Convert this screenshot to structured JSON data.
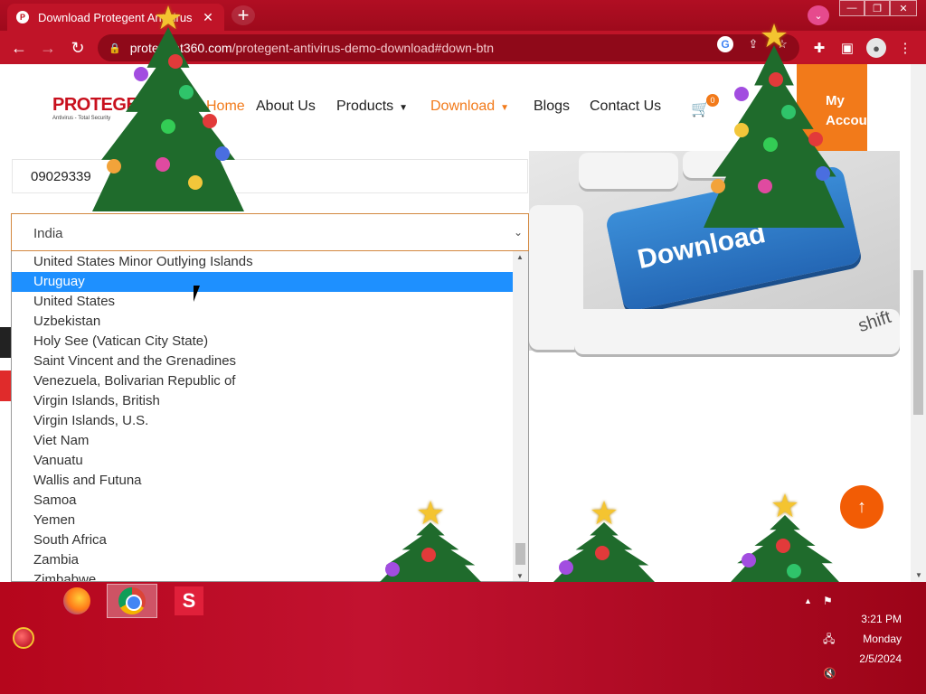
{
  "browser": {
    "tab_title": "Download Protegent Antivirus Demo",
    "tab_favicon": "P",
    "url_host": "protegent360.com",
    "url_path": "/protegent-antivirus-demo-download#down-btn"
  },
  "site": {
    "logo_brand": "PROTEGENT",
    "logo_tagline": "Antivirus - Total Security",
    "nav": {
      "home": "Home",
      "about": "About Us",
      "products": "Products",
      "download": "Download",
      "blogs": "Blogs",
      "contact": "Contact Us"
    },
    "cart_count": "0",
    "account_line1": "My",
    "account_line2": "Account"
  },
  "form": {
    "phone_value": "09029339",
    "country_selected": "India",
    "options": [
      "United States Minor Outlying Islands",
      "Uruguay",
      "United States",
      "Uzbekistan",
      "Holy See (Vatican City State)",
      "Saint Vincent and the Grenadines",
      "Venezuela, Bolivarian Republic of",
      "Virgin Islands, British",
      "Virgin Islands, U.S.",
      "Viet Nam",
      "Vanuatu",
      "Wallis and Futuna",
      "Samoa",
      "Yemen",
      "South Africa",
      "Zambia",
      "Zimbabwe"
    ],
    "highlighted_option": "Uruguay"
  },
  "image": {
    "key_label": "Download",
    "shift_label": "shift"
  },
  "taskbar": {
    "time": "3:21 PM",
    "day": "Monday",
    "date": "2/5/2024"
  },
  "colors": {
    "accent_orange": "#f27a1a",
    "browser_red": "#c01428",
    "selection_blue": "#1e90ff"
  }
}
